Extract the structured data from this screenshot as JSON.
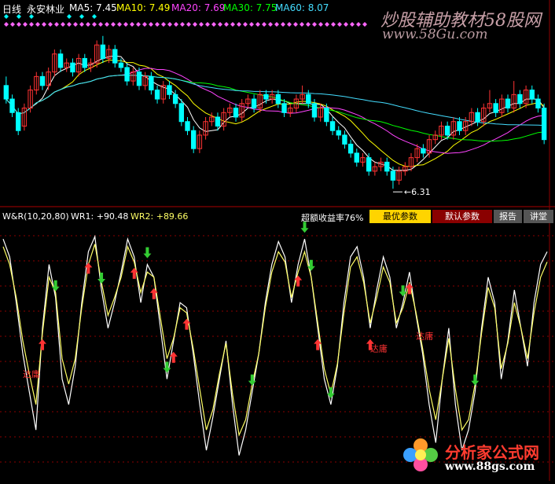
{
  "header": {
    "period": "日线",
    "stock_name": "永安林业",
    "ma": [
      {
        "label": "MA5:",
        "value": "7.45",
        "color": "#ffffff"
      },
      {
        "label": "MA10:",
        "value": "7.49",
        "color": "#ffff00"
      },
      {
        "label": "MA20:",
        "value": "7.69",
        "color": "#ff44ff"
      },
      {
        "label": "MA30:",
        "value": "7.75",
        "color": "#00ff00"
      },
      {
        "label": "MA60:",
        "value": "8.07",
        "color": "#44ddff"
      }
    ]
  },
  "watermarks": {
    "top": "炒股辅助教材58股网",
    "top_url": "www.58Gu.com",
    "bottom": "分析家公式网",
    "bottom_url": "www.88gs.com"
  },
  "colors": {
    "up": "#ff3333",
    "down": "#00ffff",
    "wr1": "#ffffff",
    "wr2": "#ffff66",
    "signal_up": "#ff3333",
    "signal_down": "#33cc33",
    "grid": "#8b0000",
    "diamond": "#ff66ff"
  },
  "indicator": {
    "title": "W&R(10,20,80)",
    "wr1_label": "WR1: +90.48",
    "wr2_label": "WR2: +89.66",
    "excess_return": "超额收益率76%",
    "buttons": [
      "最优参数",
      "默认参数",
      "报告",
      "讲堂"
    ]
  },
  "chart_data": [
    {
      "type": "candlestick",
      "title": "",
      "low_label": "6.31",
      "ylim": [
        6.0,
        9.8
      ],
      "candles": [
        [
          8.6,
          8.3,
          8.8,
          8.2
        ],
        [
          8.3,
          8.0,
          8.4,
          7.9
        ],
        [
          8.0,
          7.6,
          8.1,
          7.5
        ],
        [
          7.7,
          8.1,
          8.2,
          7.6
        ],
        [
          8.1,
          8.5,
          8.6,
          8.0
        ],
        [
          8.5,
          8.8,
          8.9,
          8.4
        ],
        [
          8.8,
          8.6,
          8.9,
          8.5
        ],
        [
          8.6,
          8.9,
          9.0,
          8.5
        ],
        [
          8.9,
          9.3,
          9.4,
          8.8
        ],
        [
          9.3,
          9.0,
          9.4,
          8.9
        ],
        [
          9.0,
          9.1,
          9.2,
          8.9
        ],
        [
          9.1,
          8.9,
          9.2,
          8.8
        ],
        [
          8.9,
          9.2,
          9.3,
          8.8
        ],
        [
          9.2,
          9.0,
          9.3,
          8.9
        ],
        [
          9.0,
          9.1,
          9.2,
          8.9
        ],
        [
          9.1,
          9.5,
          9.6,
          9.0
        ],
        [
          9.5,
          9.2,
          9.7,
          9.1
        ],
        [
          9.2,
          9.4,
          9.5,
          9.1
        ],
        [
          9.4,
          9.1,
          9.5,
          9.0
        ],
        [
          9.1,
          9.0,
          9.2,
          8.9
        ],
        [
          9.0,
          8.7,
          9.1,
          8.6
        ],
        [
          8.7,
          8.9,
          9.0,
          8.6
        ],
        [
          8.9,
          8.6,
          9.0,
          8.5
        ],
        [
          8.6,
          8.8,
          8.9,
          8.5
        ],
        [
          8.8,
          8.5,
          8.9,
          8.4
        ],
        [
          8.5,
          8.3,
          8.6,
          8.2
        ],
        [
          8.3,
          8.6,
          8.7,
          8.2
        ],
        [
          8.6,
          8.4,
          8.7,
          8.3
        ],
        [
          8.4,
          8.2,
          8.5,
          8.1
        ],
        [
          8.2,
          7.8,
          8.3,
          7.7
        ],
        [
          7.8,
          7.6,
          7.9,
          7.5
        ],
        [
          7.6,
          7.2,
          7.7,
          7.1
        ],
        [
          7.2,
          7.5,
          7.6,
          7.1
        ],
        [
          7.5,
          7.8,
          7.9,
          7.4
        ],
        [
          7.8,
          7.9,
          8.0,
          7.7
        ],
        [
          7.9,
          7.7,
          8.0,
          7.6
        ],
        [
          7.7,
          8.0,
          8.1,
          7.6
        ],
        [
          8.0,
          8.1,
          8.2,
          7.9
        ],
        [
          8.1,
          7.9,
          8.2,
          7.8
        ],
        [
          7.9,
          8.2,
          8.3,
          7.8
        ],
        [
          8.2,
          8.3,
          8.4,
          8.1
        ],
        [
          8.3,
          8.1,
          8.4,
          8.0
        ],
        [
          8.1,
          8.4,
          8.5,
          8.0
        ],
        [
          8.4,
          8.3,
          8.5,
          8.2
        ],
        [
          8.3,
          8.4,
          8.5,
          8.2
        ],
        [
          8.4,
          8.2,
          8.5,
          8.1
        ],
        [
          8.2,
          8.0,
          8.3,
          7.9
        ],
        [
          8.0,
          8.1,
          8.2,
          7.9
        ],
        [
          8.1,
          8.3,
          8.4,
          8.0
        ],
        [
          8.3,
          8.4,
          8.6,
          8.2
        ],
        [
          8.4,
          8.2,
          8.5,
          8.1
        ],
        [
          8.2,
          7.9,
          8.3,
          7.8
        ],
        [
          7.9,
          8.1,
          8.2,
          7.8
        ],
        [
          8.1,
          7.8,
          8.2,
          7.7
        ],
        [
          7.8,
          7.6,
          7.9,
          7.5
        ],
        [
          7.6,
          7.5,
          7.7,
          7.4
        ],
        [
          7.5,
          7.3,
          7.6,
          7.2
        ],
        [
          7.3,
          7.1,
          7.4,
          7.0
        ],
        [
          7.1,
          6.9,
          7.2,
          6.8
        ],
        [
          6.9,
          7.0,
          7.1,
          6.8
        ],
        [
          7.0,
          6.7,
          7.1,
          6.6
        ],
        [
          6.7,
          6.8,
          6.9,
          6.6
        ],
        [
          6.8,
          6.9,
          7.0,
          6.7
        ],
        [
          6.9,
          6.7,
          7.0,
          6.6
        ],
        [
          6.7,
          6.5,
          6.8,
          6.31
        ],
        [
          6.5,
          6.7,
          6.8,
          6.4
        ],
        [
          6.7,
          6.8,
          6.9,
          6.6
        ],
        [
          6.8,
          7.0,
          7.1,
          6.7
        ],
        [
          7.0,
          7.2,
          7.3,
          6.9
        ],
        [
          7.2,
          7.1,
          7.3,
          7.0
        ],
        [
          7.1,
          7.4,
          7.5,
          7.0
        ],
        [
          7.4,
          7.5,
          7.6,
          7.3
        ],
        [
          7.5,
          7.7,
          7.8,
          7.4
        ],
        [
          7.7,
          7.5,
          7.8,
          7.4
        ],
        [
          7.5,
          7.8,
          7.9,
          7.4
        ],
        [
          7.8,
          7.6,
          7.9,
          7.5
        ],
        [
          7.6,
          7.8,
          7.9,
          7.5
        ],
        [
          7.8,
          8.0,
          8.1,
          7.7
        ],
        [
          8.0,
          7.8,
          8.1,
          7.7
        ],
        [
          7.8,
          8.1,
          8.2,
          7.7
        ],
        [
          8.1,
          8.2,
          8.5,
          8.0
        ],
        [
          8.2,
          8.0,
          8.3,
          7.9
        ],
        [
          8.0,
          8.3,
          8.4,
          7.9
        ],
        [
          8.3,
          8.1,
          8.4,
          8.0
        ],
        [
          8.1,
          8.4,
          8.7,
          8.0
        ],
        [
          8.4,
          8.2,
          8.5,
          8.1
        ],
        [
          8.2,
          8.5,
          8.6,
          8.1
        ],
        [
          8.5,
          8.3,
          8.6,
          8.2
        ],
        [
          8.3,
          8.1,
          8.4,
          8.0
        ],
        [
          8.1,
          7.4,
          8.2,
          7.3
        ]
      ]
    },
    {
      "type": "line",
      "title": "W&R(10,20,80)",
      "ylim": [
        0,
        100
      ],
      "series": [
        {
          "name": "WR1",
          "values": [
            95,
            88,
            70,
            50,
            35,
            20,
            60,
            85,
            72,
            40,
            30,
            45,
            70,
            90,
            96,
            75,
            60,
            70,
            82,
            95,
            88,
            70,
            85,
            80,
            60,
            40,
            55,
            70,
            68,
            50,
            30,
            12,
            25,
            40,
            55,
            30,
            10,
            20,
            35,
            50,
            70,
            85,
            94,
            88,
            70,
            85,
            95,
            80,
            60,
            40,
            30,
            45,
            70,
            88,
            92,
            80,
            60,
            75,
            88,
            80,
            60,
            70,
            82,
            65,
            50,
            30,
            15,
            40,
            60,
            30,
            12,
            20,
            35,
            60,
            80,
            70,
            40,
            55,
            75,
            60,
            45,
            70,
            85,
            90
          ]
        },
        {
          "name": "WR2",
          "values": [
            92,
            85,
            72,
            55,
            42,
            30,
            58,
            80,
            74,
            48,
            38,
            48,
            68,
            85,
            93,
            78,
            65,
            72,
            80,
            92,
            86,
            74,
            82,
            80,
            64,
            48,
            56,
            68,
            66,
            52,
            36,
            20,
            28,
            42,
            54,
            34,
            18,
            24,
            38,
            50,
            68,
            82,
            90,
            86,
            72,
            82,
            90,
            80,
            62,
            44,
            34,
            46,
            66,
            84,
            88,
            78,
            62,
            72,
            84,
            78,
            62,
            68,
            78,
            66,
            52,
            36,
            24,
            40,
            56,
            36,
            20,
            24,
            38,
            58,
            76,
            68,
            44,
            54,
            70,
            60,
            48,
            66,
            80,
            86
          ]
        }
      ],
      "signals": [
        {
          "i": 6,
          "kind": "up"
        },
        {
          "i": 8,
          "kind": "down"
        },
        {
          "i": 13,
          "kind": "up"
        },
        {
          "i": 15,
          "kind": "down"
        },
        {
          "i": 20,
          "kind": "up"
        },
        {
          "i": 22,
          "kind": "down"
        },
        {
          "i": 23,
          "kind": "up"
        },
        {
          "i": 25,
          "kind": "down"
        },
        {
          "i": 26,
          "kind": "up"
        },
        {
          "i": 28,
          "kind": "up"
        },
        {
          "i": 38,
          "kind": "down"
        },
        {
          "i": 45,
          "kind": "up"
        },
        {
          "i": 46,
          "kind": "down"
        },
        {
          "i": 47,
          "kind": "down"
        },
        {
          "i": 48,
          "kind": "up"
        },
        {
          "i": 50,
          "kind": "down"
        },
        {
          "i": 56,
          "kind": "up"
        },
        {
          "i": 61,
          "kind": "down"
        },
        {
          "i": 62,
          "kind": "up"
        },
        {
          "i": 72,
          "kind": "down"
        }
      ],
      "annotations": [
        {
          "i": 3,
          "text": "达庸"
        },
        {
          "i": 56,
          "text": "达庸"
        },
        {
          "i": 63,
          "text": "达庸"
        }
      ]
    }
  ]
}
